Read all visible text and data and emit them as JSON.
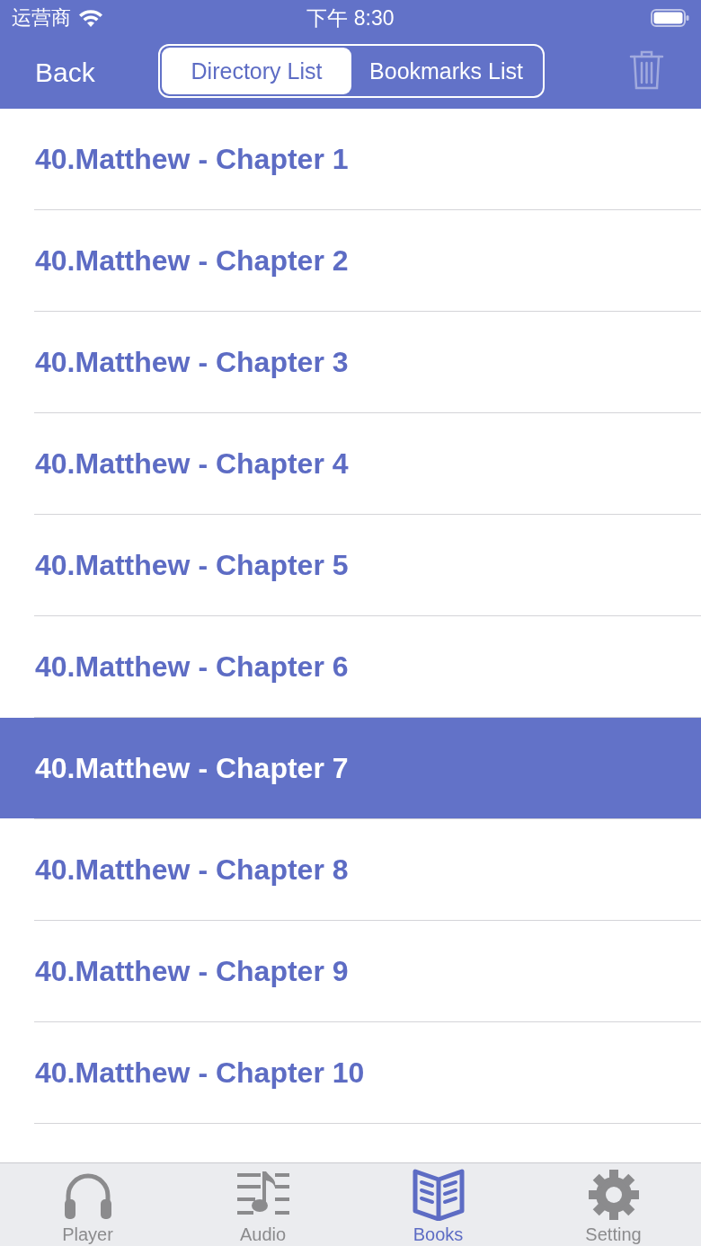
{
  "status_bar": {
    "carrier": "运营商",
    "time": "下午 8:30"
  },
  "nav_bar": {
    "back": "Back",
    "segments": [
      {
        "label": "Directory List",
        "selected": true
      },
      {
        "label": "Bookmarks List",
        "selected": false
      }
    ],
    "trash": {
      "disabled": true
    }
  },
  "chapters": [
    {
      "title": "40.Matthew - Chapter 1",
      "selected": false
    },
    {
      "title": "40.Matthew - Chapter 2",
      "selected": false
    },
    {
      "title": "40.Matthew - Chapter 3",
      "selected": false
    },
    {
      "title": "40.Matthew - Chapter 4",
      "selected": false
    },
    {
      "title": "40.Matthew - Chapter 5",
      "selected": false
    },
    {
      "title": "40.Matthew - Chapter 6",
      "selected": false
    },
    {
      "title": "40.Matthew - Chapter 7",
      "selected": true
    },
    {
      "title": "40.Matthew - Chapter 8",
      "selected": false
    },
    {
      "title": "40.Matthew - Chapter 9",
      "selected": false
    },
    {
      "title": "40.Matthew - Chapter 10",
      "selected": false
    }
  ],
  "tab_bar": [
    {
      "label": "Player",
      "kind": "headphones",
      "selected": false
    },
    {
      "label": "Audio",
      "kind": "music",
      "selected": false
    },
    {
      "label": "Books",
      "kind": "book",
      "selected": true
    },
    {
      "label": "Setting",
      "kind": "gear",
      "selected": false
    }
  ]
}
